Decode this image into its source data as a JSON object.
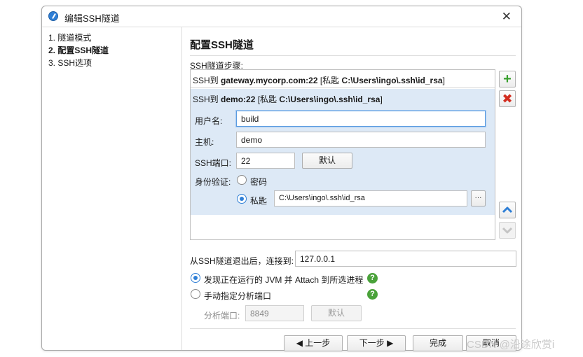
{
  "window": {
    "title": "编辑SSH隧道",
    "close_glyph": "✕"
  },
  "steps": [
    {
      "label": "1. 隧道模式",
      "active": false
    },
    {
      "label": "2. 配置SSH隧道",
      "active": true
    },
    {
      "label": "3. SSH选项",
      "active": false
    }
  ],
  "page": {
    "title": "配置SSH隧道",
    "steps_label": "SSH隧道步骤:"
  },
  "tunnels": [
    {
      "prefix": "SSH到 ",
      "host": "gateway.mycorp.com:22",
      "key_prefix": " [私匙 ",
      "key": "C:\\Users\\ingo\\.ssh\\id_rsa",
      "suffix": "]"
    },
    {
      "prefix": "SSH到 ",
      "host": "demo:22",
      "key_prefix": " [私匙 ",
      "key": "C:\\Users\\ingo\\.ssh\\id_rsa",
      "suffix": "]"
    }
  ],
  "editor": {
    "username_label": "用户名:",
    "username_value": "build",
    "host_label": "主机:",
    "host_value": "demo",
    "port_label": "SSH端口:",
    "port_value": "22",
    "default_button": "默认",
    "auth_label": "身份验证:",
    "auth_password": "密码",
    "auth_key": "私匙",
    "auth_selected": "私匙",
    "key_path": "C:\\Users\\ingo\\.ssh\\id_rsa",
    "browse_button": "···"
  },
  "side_buttons": {
    "add_icon": "plus-icon",
    "remove_icon": "delete-icon",
    "up_icon": "arrow-up-icon",
    "down_icon": "arrow-down-icon"
  },
  "connect": {
    "label": "从SSH隧道退出后，连接到:",
    "value": "127.0.0.1"
  },
  "options": {
    "discover_label": "发现正在运行的 JVM 并 Attach 到所选进程",
    "manual_label": "手动指定分析端口",
    "selected": "discover",
    "port_label": "分析端口:",
    "port_value": "8849",
    "default_button": "默认"
  },
  "footer": {
    "prev": "上一步",
    "next": "下一步",
    "finish": "完成",
    "cancel": "取消"
  },
  "watermark": "CSDN @沿途欣赏i",
  "colors": {
    "accent": "#2f7fd6",
    "selection": "#dde9f6",
    "add": "#3aa02f",
    "remove": "#d22c1f",
    "help": "#4aa23a"
  }
}
